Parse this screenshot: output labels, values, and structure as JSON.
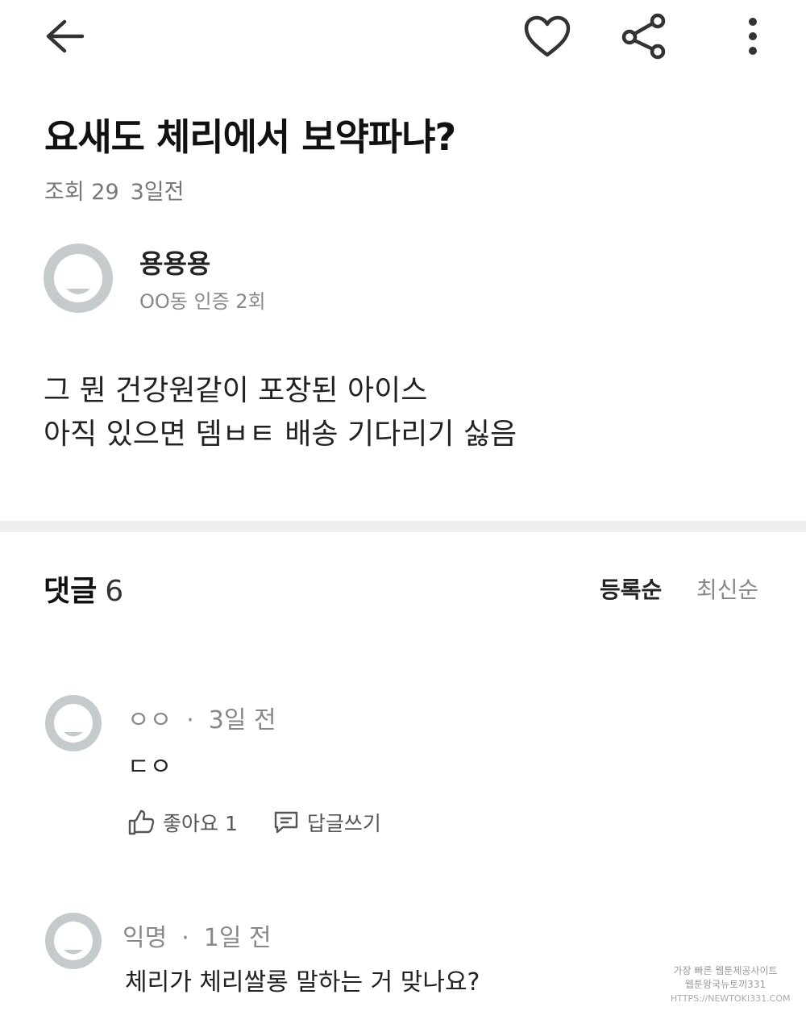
{
  "header": {
    "back_icon": "arrow-left-icon",
    "like_icon": "heart-icon",
    "share_icon": "share-icon",
    "more_icon": "more-vertical-icon"
  },
  "post": {
    "title": "요새도 체리에서 보약파냐?",
    "views": "조회 29",
    "age": "3일전",
    "author": {
      "name": "용용용",
      "verification": "OO동 인증 2회"
    },
    "body_lines": [
      "그 뭔 건강원같이 포장된 아이스",
      "아직 있으면 뎀ㅂㅌ 배송 기다리기 싫음"
    ]
  },
  "comments_section": {
    "label": "댓글",
    "count": "6",
    "sort_registered": "등록순",
    "sort_latest": "최신순",
    "items": [
      {
        "author": "ㅇㅇ",
        "separator": "·",
        "time": "3일 전",
        "text": "ㄷㅇ",
        "like_label": "좋아요 1",
        "reply_label": "답글쓰기"
      },
      {
        "author": "익명",
        "separator": "·",
        "time": "1일 전",
        "text": "체리가 체리쌀롱 말하는 거 맞나요?"
      }
    ]
  },
  "watermark": {
    "line1": "가장 빠른 웹툰제공사이트",
    "line2": "웹툰왕국뉴토끼331",
    "line3": "HTTPS://NEWTOKI331.COM"
  },
  "colors": {
    "text_primary": "#111111",
    "text_secondary": "#888888",
    "avatar_bg": "#c5cbcd",
    "divider": "#eeeeee"
  }
}
